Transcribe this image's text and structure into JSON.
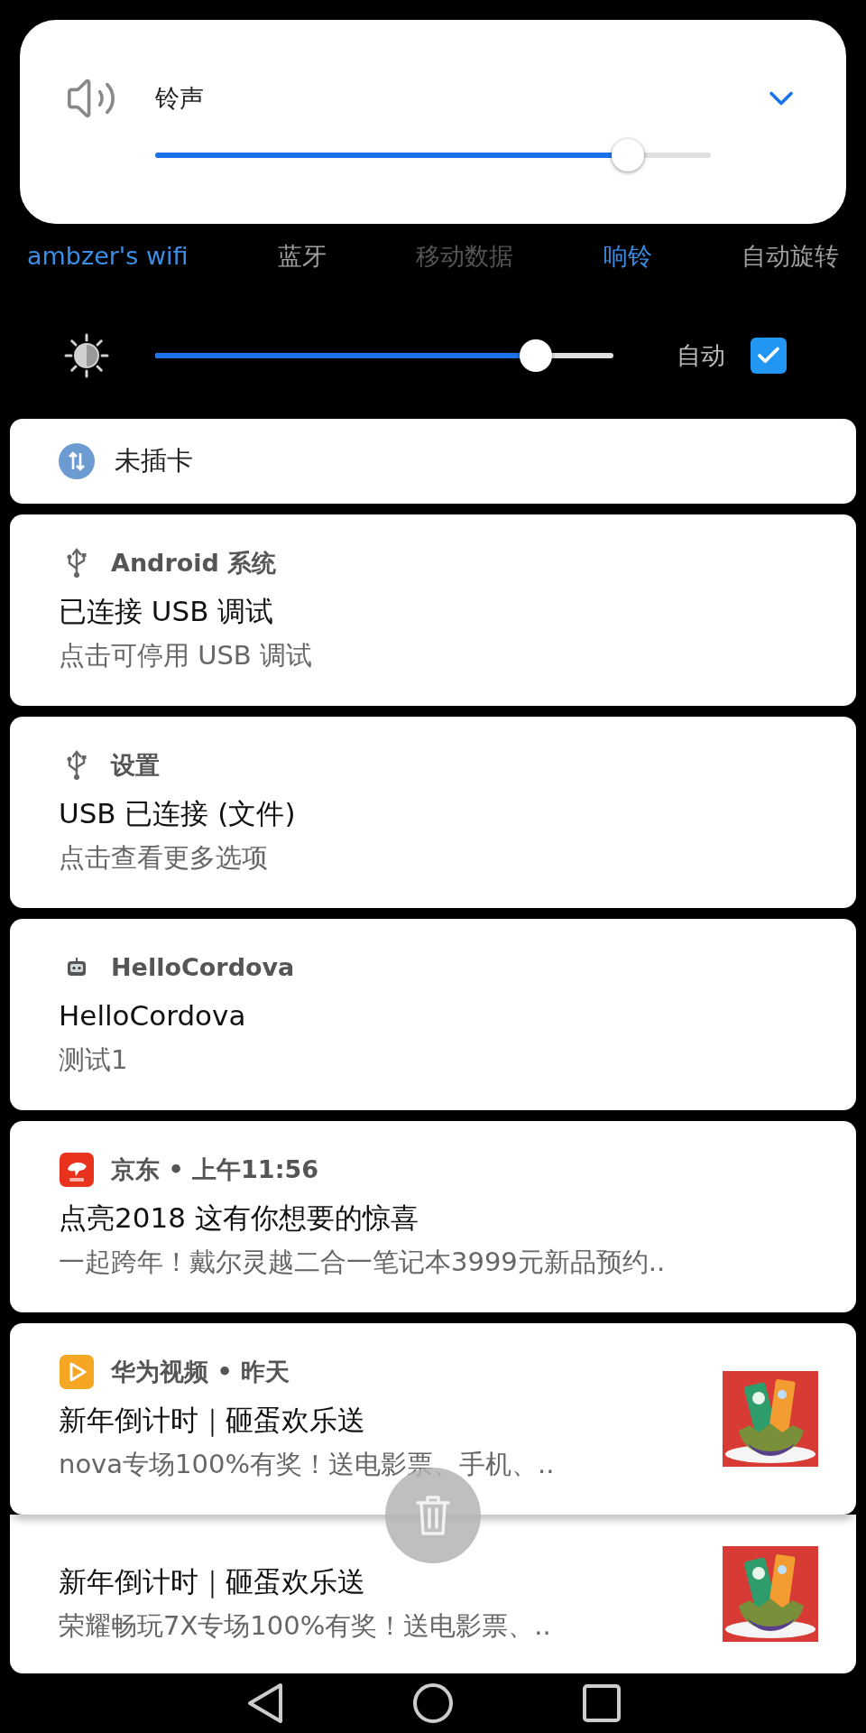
{
  "volume_panel": {
    "label": "铃声",
    "level": 0.85
  },
  "quick_settings": [
    {
      "label": "ambzer's wifi",
      "on": true,
      "disabled": false
    },
    {
      "label": "蓝牙",
      "on": false,
      "disabled": false
    },
    {
      "label": "移动数据",
      "on": false,
      "disabled": true
    },
    {
      "label": "响铃",
      "on": true,
      "disabled": false
    },
    {
      "label": "自动旋转",
      "on": false,
      "disabled": false
    }
  ],
  "brightness": {
    "level": 0.83,
    "auto_label": "自动",
    "auto_checked": true
  },
  "notifications": [
    {
      "kind": "status",
      "title": "未插卡"
    },
    {
      "kind": "message",
      "app": "Android 系统",
      "title": "已连接 USB 调试",
      "body": "点击可停用 USB 调试"
    },
    {
      "kind": "message",
      "app": "设置",
      "title": "USB 已连接 (文件)",
      "body": "点击查看更多选项"
    },
    {
      "kind": "message",
      "app": "HelloCordova",
      "title": "HelloCordova",
      "body": "测试1"
    },
    {
      "kind": "message",
      "app": "京东 • 上午11:56",
      "title": "点亮2018 这有你想要的惊喜",
      "body": "一起跨年！戴尔灵越二合一笔记本3999元新品预约.."
    },
    {
      "app": "华为视频 • 昨天",
      "title": "新年倒计时｜砸蛋欢乐送",
      "body": "nova专场100%有奖！送电影票、手机、.."
    },
    {
      "kind": "stacked",
      "title": "新年倒计时｜砸蛋欢乐送",
      "body": "荣耀畅玩7X专场100%有奖！送电影票、.."
    }
  ]
}
